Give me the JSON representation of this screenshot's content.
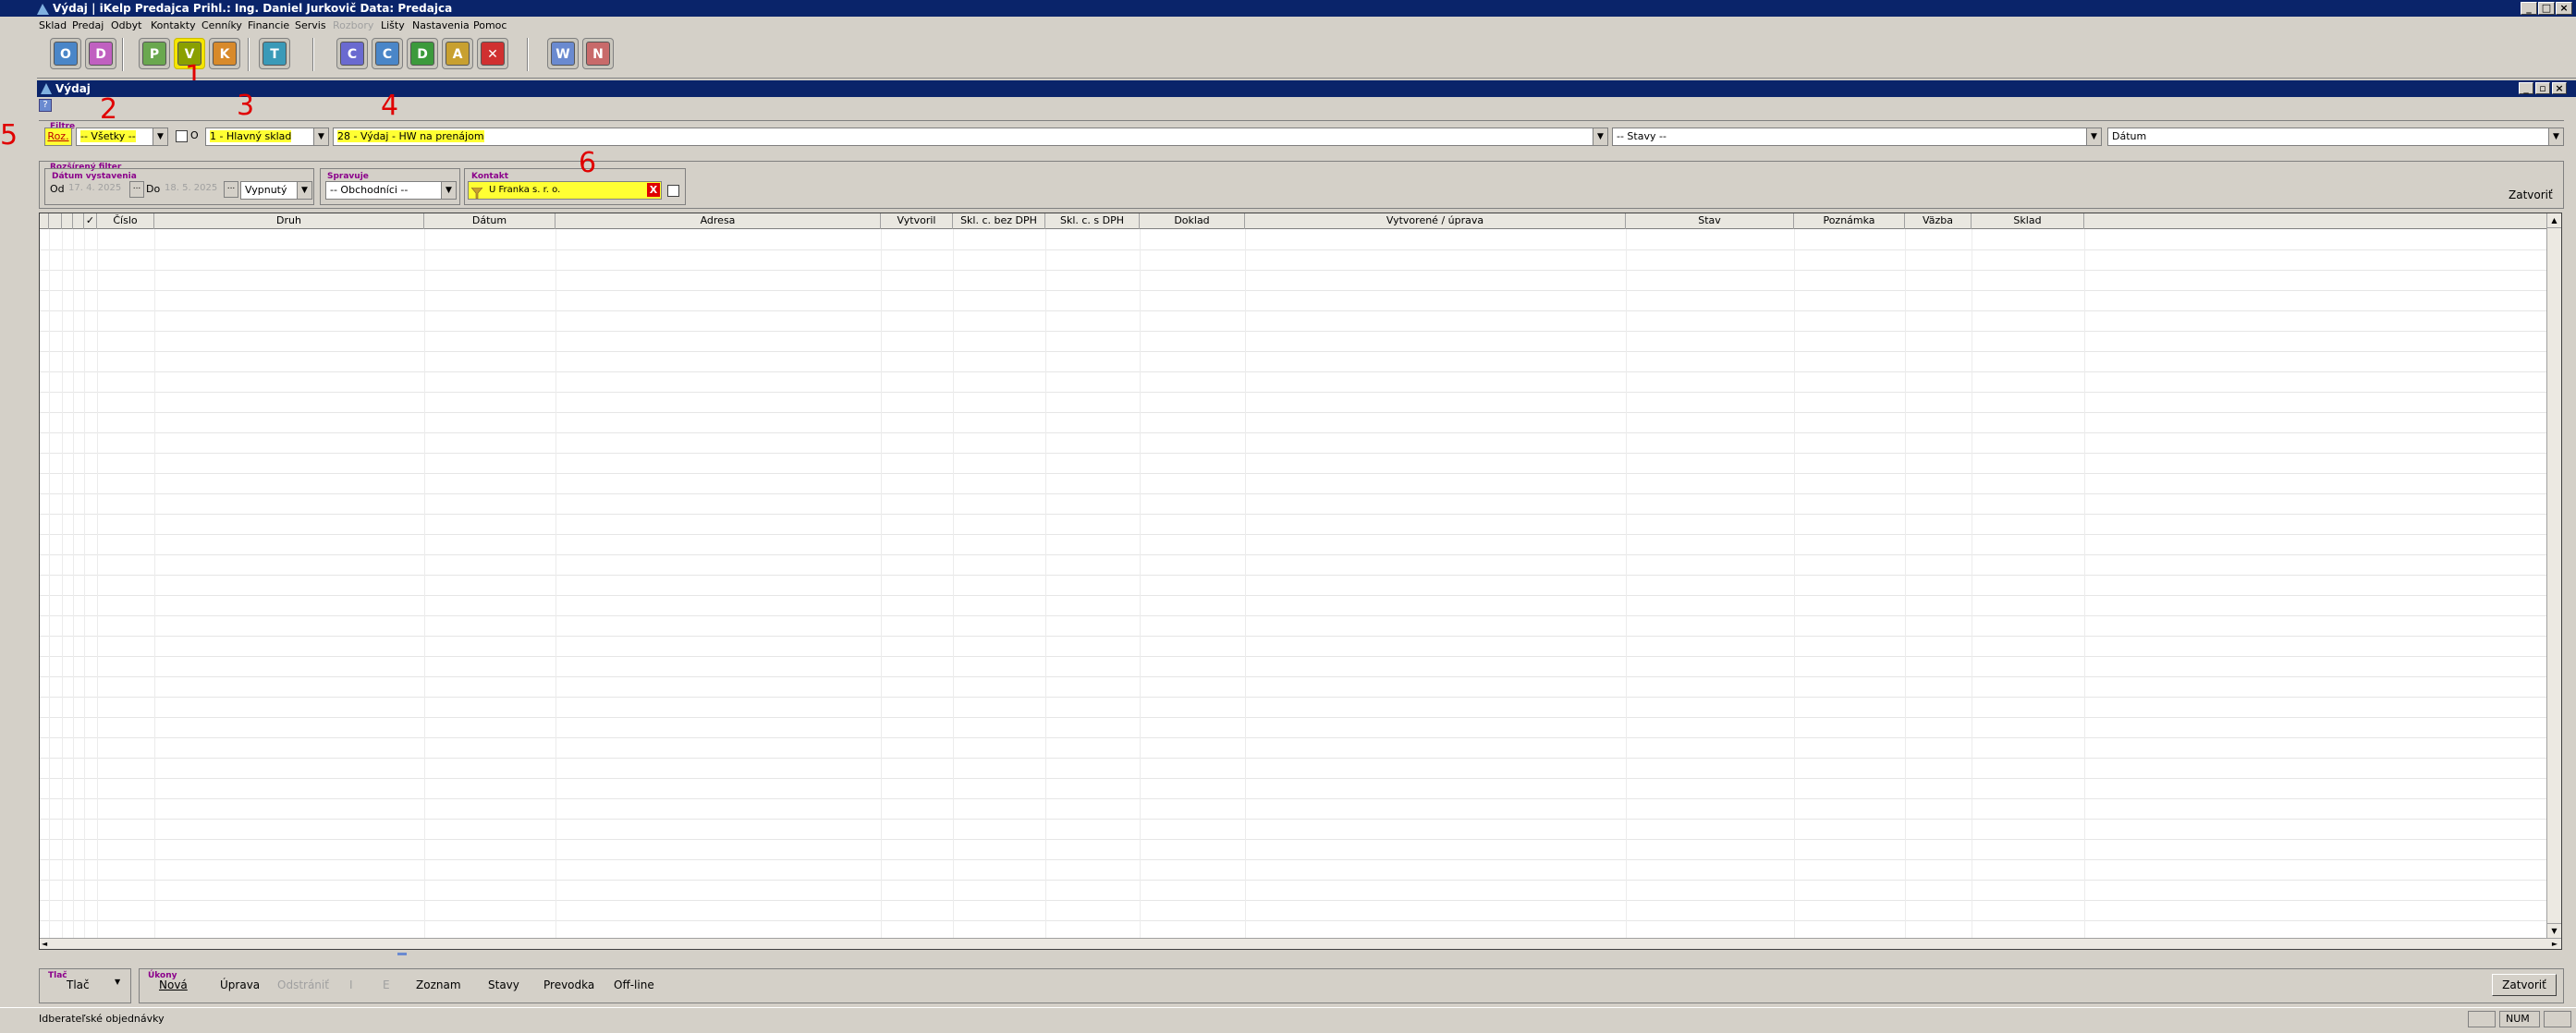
{
  "window": {
    "title": "Výdaj | iKelp Predajca    Prihl.: Ing. Daniel Jurkovič    Data: Predajca"
  },
  "menu": [
    "Sklad",
    "Predaj",
    "Odbyt",
    "Kontakty",
    "Cenníky",
    "Financie",
    "Servis",
    "Rozbory",
    "Lišty",
    "Nastavenia",
    "Pomoc"
  ],
  "toolbar": {
    "buttons": [
      {
        "icon": "os-icon",
        "glyph": "O",
        "color": "#4a86c8"
      },
      {
        "icon": "ds-icon",
        "glyph": "D",
        "color": "#c060c0"
      },
      {
        "icon": "prijem-icon",
        "glyph": "P",
        "color": "#6aa84f"
      },
      {
        "icon": "vydaj-icon",
        "glyph": "V",
        "color": "#8aa000"
      },
      {
        "icon": "k-icon",
        "glyph": "K",
        "color": "#d88a2a"
      },
      {
        "icon": "t-icon",
        "glyph": "T",
        "color": "#3a9ab8"
      },
      {
        "icon": "c1-icon",
        "glyph": "C",
        "color": "#6a6ad0"
      },
      {
        "icon": "c2-icon",
        "glyph": "C",
        "color": "#4a86c8"
      },
      {
        "icon": "d-icon",
        "glyph": "D",
        "color": "#3c9a3c"
      },
      {
        "icon": "a-icon",
        "glyph": "A",
        "color": "#c8a030"
      },
      {
        "icon": "close-red-icon",
        "glyph": "✕",
        "color": "#d03030"
      },
      {
        "icon": "word-icon",
        "glyph": "W",
        "color": "#6a8ad0"
      },
      {
        "icon": "note-icon",
        "glyph": "N",
        "color": "#c86a6a"
      }
    ]
  },
  "doc": {
    "title": "Výdaj"
  },
  "filter": {
    "label": "Filtre",
    "roz": "Roz.",
    "vsetky": "-- Všetky --",
    "o": "O",
    "sklad": "1 - Hlavný sklad",
    "druh": "28 - Výdaj - HW na prenájom",
    "stavy": "-- Stavy --",
    "datum": "Dátum"
  },
  "ext": {
    "label": "Rozšírený filter",
    "datum_label": "Dátum vystavenia",
    "od": "Od",
    "od_val": "17. 4. 2025",
    "do": "Do",
    "do_val": "18. 5. 2025",
    "dots": "...",
    "vypnuty": "Vypnutý",
    "spravuje_label": "Spravuje",
    "spravuje": "-- Obchodníci --",
    "kontakt_label": "Kontakt",
    "kontakt": "U Franka s. r. o.",
    "zatvorit": "Zatvoriť"
  },
  "annotations": [
    "1",
    "2",
    "3",
    "4",
    "5",
    "6"
  ],
  "grid": {
    "columns": [
      "",
      "",
      "",
      "Číslo",
      "Druh",
      "Dátum",
      "Adresa",
      "Vytvoril",
      "Skl. c. bez DPH",
      "Skl. c. s DPH",
      "Doklad",
      "Vytvorené / úprava",
      "Stav",
      "Poznámka",
      "Väzba",
      "Sklad"
    ]
  },
  "footer": {
    "tlac_label": "Tlač",
    "tlac": "Tlač",
    "ukony_label": "Úkony",
    "actions": [
      "Nová",
      "Úprava",
      "Odstrániť",
      "I",
      "E",
      "Zoznam",
      "Stavy",
      "Prevodka",
      "Off-line"
    ],
    "zatvorit": "Zatvoriť"
  },
  "status": {
    "text": "Idberateľské objednávky",
    "num": "NUM"
  }
}
